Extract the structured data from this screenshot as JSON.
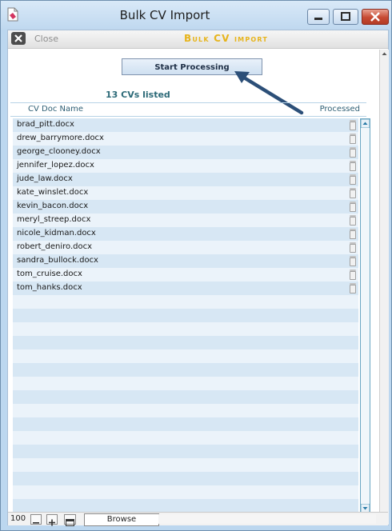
{
  "window": {
    "title": "Bulk CV Import",
    "buttons": [
      "minimize",
      "maximize",
      "close"
    ]
  },
  "toolbar": {
    "close_label": "Close",
    "heading": "Bulk CV import"
  },
  "actions": {
    "start_label": "Start Processing"
  },
  "summary": {
    "count_label": "13 CVs listed"
  },
  "table": {
    "columns": [
      "CV Doc Name",
      "Processed"
    ],
    "rows": [
      "brad_pitt.docx",
      "drew_barrymore.docx",
      "george_clooney.docx",
      "jennifer_lopez.docx",
      "jude_law.docx",
      "kate_winslet.docx",
      "kevin_bacon.docx",
      "meryl_streep.docx",
      "nicole_kidman.docx",
      "robert_deniro.docx",
      "sandra_bullock.docx",
      "tom_cruise.docx",
      "tom_hanks.docx"
    ]
  },
  "statusbar": {
    "zoom": "100",
    "mode": "Browse"
  },
  "colors": {
    "heading": "#e7b41b",
    "row_odd": "#d7e7f4",
    "row_even": "#ebf3fa",
    "arrow": "#2c4f78"
  },
  "icons": {
    "app": "document-icon",
    "close": "close-x-icon",
    "processed": "checkbox-icon",
    "zoom_out": "minus-icon",
    "zoom_in": "plus-icon",
    "layout": "layout-icon"
  }
}
